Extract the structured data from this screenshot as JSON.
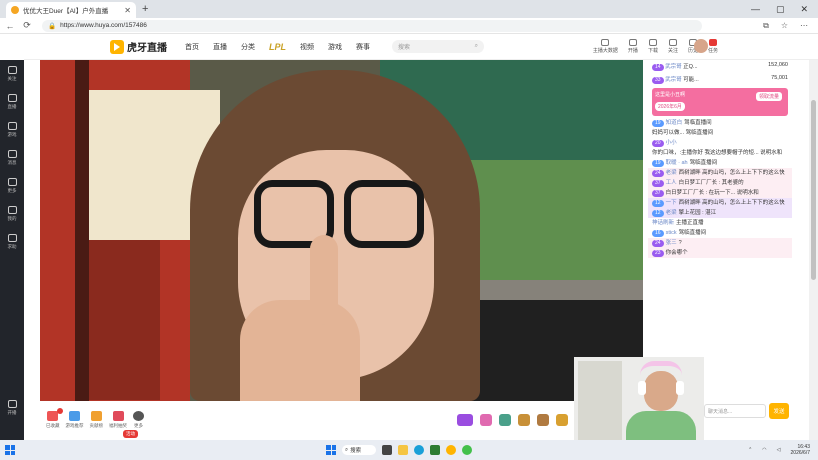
{
  "browser": {
    "tab_title": "优优大王Duer【AI】户外直播",
    "url": "https://www.huya.com/157486"
  },
  "header": {
    "logo": "虎牙直播",
    "nav": [
      "首页",
      "直播",
      "分类",
      "LPL",
      "视频",
      "游戏",
      "赛事"
    ],
    "search_placeholder": "搜索",
    "right": [
      "主播大数据",
      "开播",
      "下载",
      "关注",
      "历史",
      "任务"
    ]
  },
  "sidebar": {
    "items": [
      "关注",
      "直播",
      "游戏",
      "消息",
      "更多",
      "我的",
      "求助"
    ],
    "bottom": "开播"
  },
  "gift_bar": {
    "left": [
      "已收藏",
      "游戏推荐",
      "贡献榜",
      "福利抽奖",
      "更多"
    ],
    "hot_tag": "活动"
  },
  "chat": {
    "top": [
      {
        "lv": "14",
        "name": "武宗哥",
        "text": "正Q...",
        "count": "152,060"
      },
      {
        "lv": "33",
        "name": "武宗哥",
        "text": "可能...",
        "count": "75,001"
      }
    ],
    "banner": {
      "title": "这里是小丑啊",
      "btn": "领取流量",
      "date": "2026年6月"
    },
    "messages": [
      {
        "lv": "19",
        "name": "知道白",
        "text": "驾临直播间",
        "style": ""
      },
      {
        "lv": "",
        "name": "",
        "text": "妈妈可以做... 驾临直播间",
        "style": ""
      },
      {
        "lv": "20",
        "name": "小小",
        "text": "你的口味，:主播你好 我这边想要帽子的短... 说明水和",
        "style": ""
      },
      {
        "lv": "19",
        "name": "取暖 · ah",
        "text": "驾临直播间",
        "style": ""
      },
      {
        "lv": "24",
        "name": "老梁",
        "text": "西树湖畔 高的山吗，怎么上上下下的这么快",
        "style": "pink"
      },
      {
        "lv": "37",
        "name": "工人",
        "text": "白日梦工厂厂长 : 其老婆的",
        "style": "pink"
      },
      {
        "lv": "37",
        "name": "",
        "text": "白日梦工厂厂长 : 在玩一下... 说明水和",
        "style": "pink"
      },
      {
        "lv": "12",
        "name": "一下",
        "text": "西树湖畔 高的山吗，怎么上上下下的这么快",
        "style": "purple"
      },
      {
        "lv": "12",
        "name": "老梁",
        "text": "擎上花园 : 湛江",
        "style": "purple"
      },
      {
        "lv": "",
        "name": "神话刷新",
        "text": "主播正直播",
        "style": ""
      },
      {
        "lv": "16",
        "name": "stick",
        "text": "驾临直播间",
        "style": ""
      },
      {
        "lv": "24",
        "name": "张三",
        "text": "? ",
        "style": "pink"
      },
      {
        "lv": "23",
        "name": "",
        "text": "你会哪个",
        "style": "pink"
      }
    ],
    "input_placeholder": "聊天消息...",
    "send": "发送"
  },
  "taskbar": {
    "search": "搜索",
    "time": "16:43",
    "date": "2026/6/7"
  },
  "colors": {
    "brand": "#ffb400",
    "pink_banner": "#f46ea0",
    "sidebar_bg": "#22252b"
  }
}
